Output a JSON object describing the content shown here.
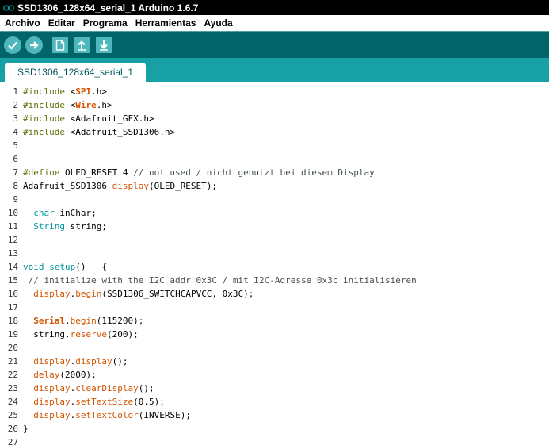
{
  "window": {
    "title": "SSD1306_128x64_serial_1 Arduino 1.6.7"
  },
  "menubar": {
    "items": [
      {
        "id": "archivo",
        "label": "Archivo"
      },
      {
        "id": "editar",
        "label": "Editar"
      },
      {
        "id": "programa",
        "label": "Programa"
      },
      {
        "id": "herramientas",
        "label": "Herramientas"
      },
      {
        "id": "ayuda",
        "label": "Ayuda"
      }
    ]
  },
  "toolbar": {
    "buttons": [
      {
        "id": "verify",
        "icon": "checkmark-icon"
      },
      {
        "id": "upload",
        "icon": "arrow-right-icon"
      },
      {
        "id": "new",
        "icon": "file-icon"
      },
      {
        "id": "open",
        "icon": "arrow-up-icon"
      },
      {
        "id": "save",
        "icon": "arrow-down-icon"
      }
    ]
  },
  "tabs": [
    {
      "label": "SSD1306_128x64_serial_1"
    }
  ],
  "colors": {
    "toolbar_bg": "#006468",
    "tabstrip_bg": "#17a1a5",
    "button_bg": "#4db7bb",
    "keyword_orange": "#d35400",
    "keyword_teal": "#00979c",
    "directive_olive": "#5e6d03"
  },
  "editor": {
    "lines": [
      {
        "n": "1",
        "t": [
          [
            "k-dir",
            "#include "
          ],
          [
            "",
            "<"
          ],
          [
            "k-lib",
            "SPI"
          ],
          [
            "",
            ".h>"
          ]
        ]
      },
      {
        "n": "2",
        "t": [
          [
            "k-dir",
            "#include "
          ],
          [
            "",
            "<"
          ],
          [
            "k-lib",
            "Wire"
          ],
          [
            "",
            ".h>"
          ]
        ]
      },
      {
        "n": "3",
        "t": [
          [
            "k-dir",
            "#include "
          ],
          [
            "",
            "<Adafruit_GFX.h>"
          ]
        ]
      },
      {
        "n": "4",
        "t": [
          [
            "k-dir",
            "#include "
          ],
          [
            "",
            "<Adafruit_SSD1306.h>"
          ]
        ]
      },
      {
        "n": "5",
        "t": []
      },
      {
        "n": "6",
        "t": []
      },
      {
        "n": "7",
        "t": [
          [
            "k-dir",
            "#define "
          ],
          [
            "",
            "OLED_RESET 4 "
          ],
          [
            "k-comment",
            "// not used / nicht genutzt bei diesem Display"
          ]
        ]
      },
      {
        "n": "8",
        "t": [
          [
            "",
            "Adafruit_SSD1306 "
          ],
          [
            "k-fn",
            "display"
          ],
          [
            "",
            "(OLED_RESET);"
          ]
        ]
      },
      {
        "n": "9",
        "t": []
      },
      {
        "n": "10",
        "t": [
          [
            "",
            "  "
          ],
          [
            "k-type",
            "char"
          ],
          [
            "",
            " inChar;"
          ]
        ]
      },
      {
        "n": "11",
        "t": [
          [
            "",
            "  "
          ],
          [
            "k-type",
            "String"
          ],
          [
            "",
            " string;"
          ]
        ]
      },
      {
        "n": "12",
        "t": []
      },
      {
        "n": "13",
        "t": []
      },
      {
        "n": "14",
        "t": [
          [
            "k-type",
            "void"
          ],
          [
            "",
            " "
          ],
          [
            "k-type",
            "setup"
          ],
          [
            "",
            "()   {"
          ]
        ]
      },
      {
        "n": "15",
        "t": [
          [
            "k-comment",
            " // initialize with the I2C addr 0x3C / mit I2C-Adresse 0x3c initialisieren"
          ]
        ]
      },
      {
        "n": "16",
        "t": [
          [
            "",
            "  "
          ],
          [
            "k-fn",
            "display"
          ],
          [
            "",
            "."
          ],
          [
            "k-fn",
            "begin"
          ],
          [
            "",
            "(SSD1306_SWITCHCAPVCC, 0x3C);"
          ]
        ]
      },
      {
        "n": "17",
        "t": []
      },
      {
        "n": "18",
        "t": [
          [
            "",
            "  "
          ],
          [
            "k-lib",
            "Serial"
          ],
          [
            "",
            "."
          ],
          [
            "k-fn",
            "begin"
          ],
          [
            "",
            "(115200);"
          ]
        ]
      },
      {
        "n": "19",
        "t": [
          [
            "",
            "  string."
          ],
          [
            "k-fn",
            "reserve"
          ],
          [
            "",
            "(200);"
          ]
        ]
      },
      {
        "n": "20",
        "t": []
      },
      {
        "n": "21",
        "t": [
          [
            "",
            "  "
          ],
          [
            "k-fn",
            "display"
          ],
          [
            "",
            "."
          ],
          [
            "k-fn",
            "display"
          ],
          [
            "",
            "();"
          ]
        ],
        "cursor": true
      },
      {
        "n": "22",
        "t": [
          [
            "",
            "  "
          ],
          [
            "k-fn",
            "delay"
          ],
          [
            "",
            "(2000);"
          ]
        ]
      },
      {
        "n": "23",
        "t": [
          [
            "",
            "  "
          ],
          [
            "k-fn",
            "display"
          ],
          [
            "",
            "."
          ],
          [
            "k-fn",
            "clearDisplay"
          ],
          [
            "",
            "();"
          ]
        ]
      },
      {
        "n": "24",
        "t": [
          [
            "",
            "  "
          ],
          [
            "k-fn",
            "display"
          ],
          [
            "",
            "."
          ],
          [
            "k-fn",
            "setTextSize"
          ],
          [
            "",
            "(0.5);"
          ]
        ]
      },
      {
        "n": "25",
        "t": [
          [
            "",
            "  "
          ],
          [
            "k-fn",
            "display"
          ],
          [
            "",
            "."
          ],
          [
            "k-fn",
            "setTextColor"
          ],
          [
            "",
            "(INVERSE);"
          ]
        ]
      },
      {
        "n": "26",
        "t": [
          [
            "",
            "}"
          ]
        ]
      },
      {
        "n": "27",
        "t": []
      }
    ]
  }
}
